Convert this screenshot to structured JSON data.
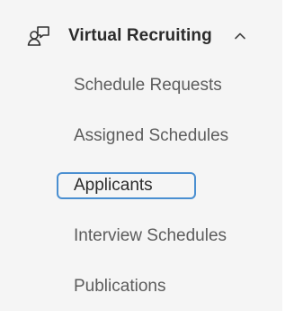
{
  "nav": {
    "section": {
      "title": "Virtual Recruiting",
      "icon": "people-chat-icon",
      "expanded": true,
      "chevron_icon": "chevron-up-icon"
    },
    "items": [
      {
        "label": "Schedule Requests",
        "active": false
      },
      {
        "label": "Assigned Schedules",
        "active": false
      },
      {
        "label": "Applicants",
        "active": true
      },
      {
        "label": "Interview Schedules",
        "active": false
      },
      {
        "label": "Publications",
        "active": false
      }
    ]
  },
  "colors": {
    "panel_bg": "#f5f5f5",
    "text_primary": "#2b2b2b",
    "text_secondary": "#5c5c5c",
    "highlight": "#4a8fd1"
  }
}
